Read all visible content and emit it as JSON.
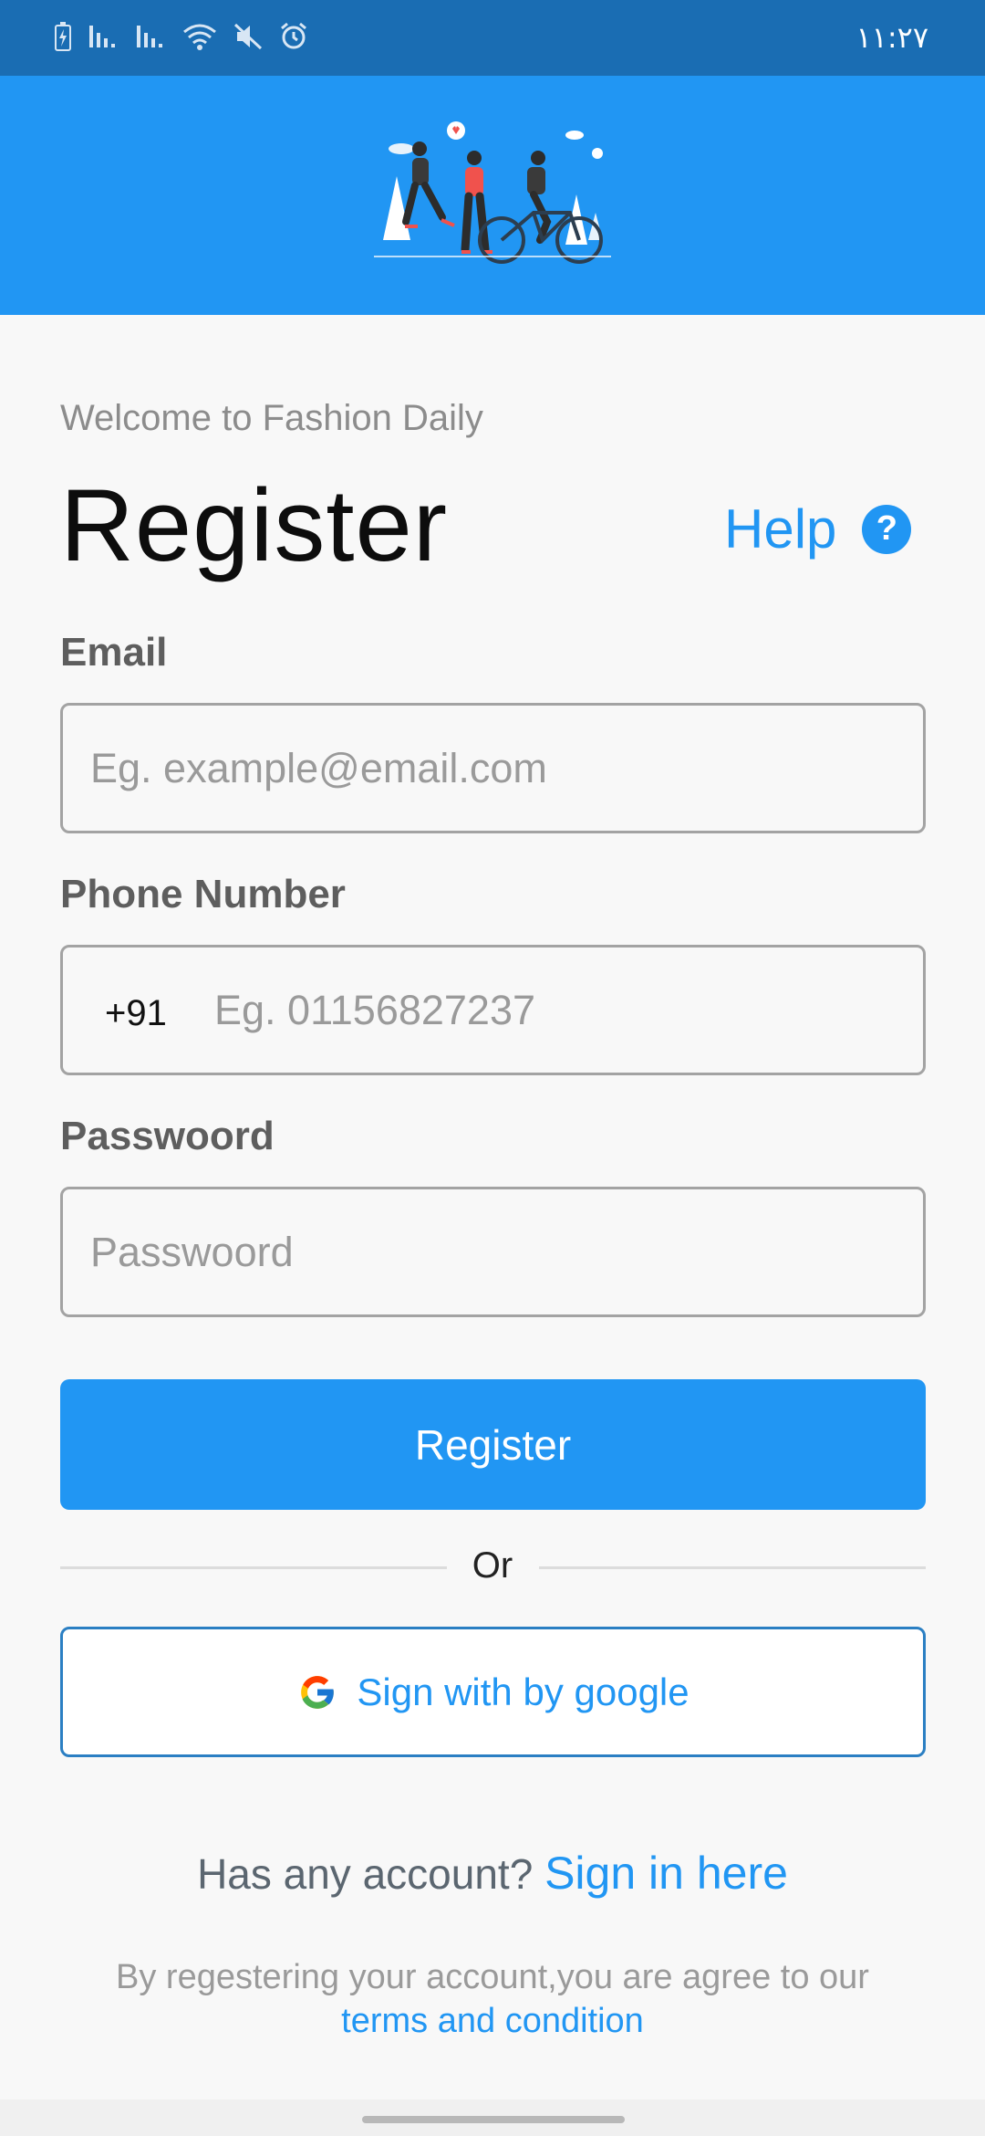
{
  "status_bar": {
    "time": "١١:٢٧",
    "icons": [
      "battery-charging-icon",
      "signal-icon",
      "signal-icon",
      "wifi-icon",
      "mute-icon",
      "alarm-icon"
    ],
    "background": "#1a6db3"
  },
  "header": {
    "illustration": "people-running-cycling-illustration",
    "background": "#2196f3"
  },
  "welcome_text": "Welcome to Fashion Daily",
  "title": "Register",
  "help": {
    "label": "Help",
    "icon": "question-icon",
    "icon_glyph": "?"
  },
  "form": {
    "email": {
      "label": "Email",
      "placeholder": "Eg. example@email.com",
      "value": ""
    },
    "phone": {
      "label": "Phone Number",
      "prefix": "+91",
      "placeholder": "Eg. 01156827237",
      "value": ""
    },
    "password": {
      "label": "Passwoord",
      "placeholder": "Passwoord",
      "value": ""
    },
    "submit_label": "Register"
  },
  "divider_text": "Or",
  "google_button": {
    "label": "Sign with by google",
    "icon": "google-icon"
  },
  "account": {
    "question": "Has any account?",
    "link": "Sign in here"
  },
  "terms": {
    "text": "By regestering your account,you are agree to our",
    "link": "terms and condition"
  },
  "colors": {
    "accent": "#2196f3",
    "page_background": "#f8f8f8"
  }
}
